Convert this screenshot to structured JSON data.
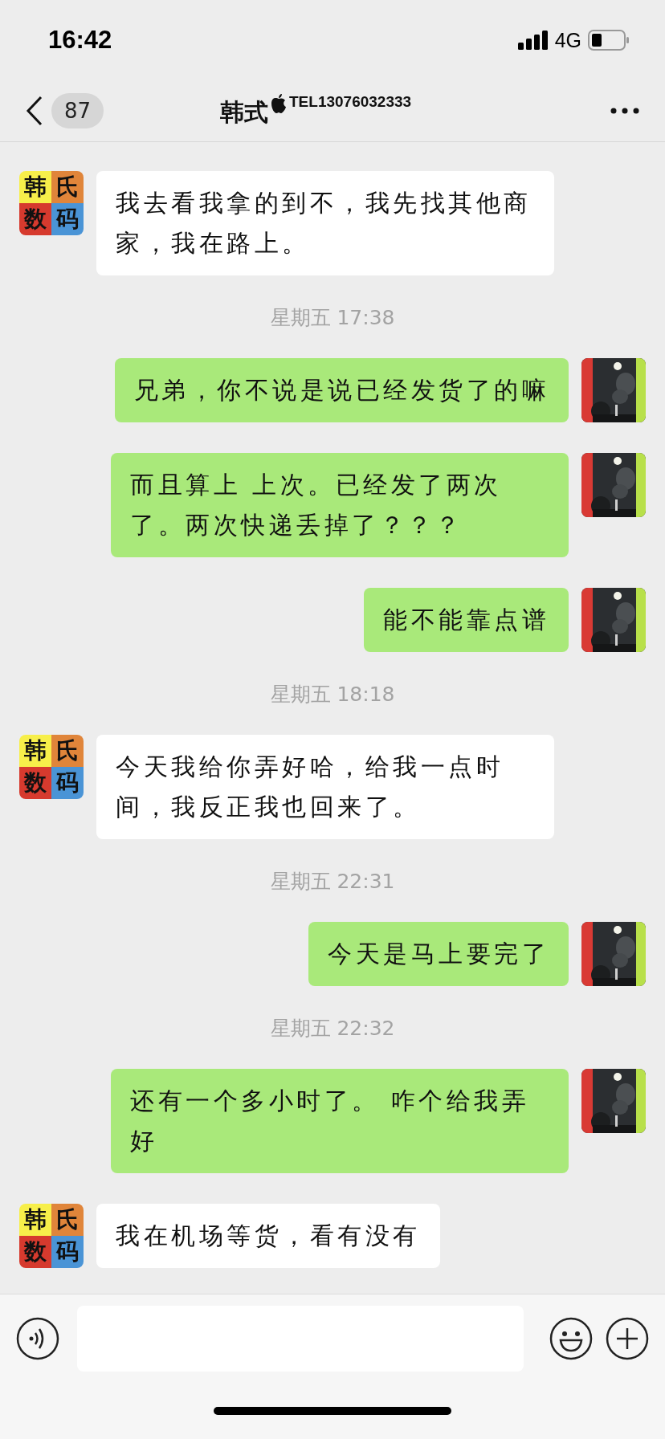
{
  "status_bar": {
    "time": "16:42",
    "network": "4G"
  },
  "nav": {
    "unread_count": "87",
    "title": "韩式",
    "title_suffix": "TEL13076032333"
  },
  "messages": [
    {
      "kind": "incoming",
      "text": "我去看我拿的到不，我先找其他商家，我在路上。",
      "avatar": [
        {
          "text": "韩",
          "color": "#f7ef4a"
        },
        {
          "text": "氏",
          "color": "#e0853a"
        },
        {
          "text": "数",
          "color": "#d63a2e"
        },
        {
          "text": "码",
          "color": "#4a94d6"
        }
      ]
    },
    {
      "kind": "time",
      "text": "星期五 17:38"
    },
    {
      "kind": "outgoing",
      "text": "兄弟，你不说是说已经发货了的嘛"
    },
    {
      "kind": "outgoing",
      "text": "而且算上 上次。已经发了两次了。两次快递丢掉了？？？"
    },
    {
      "kind": "outgoing",
      "text": "能不能靠点谱"
    },
    {
      "kind": "time",
      "text": "星期五 18:18"
    },
    {
      "kind": "incoming",
      "text": "今天我给你弄好哈，给我一点时间，我反正我也回来了。",
      "avatar": [
        {
          "text": "韩",
          "color": "#f7ef4a"
        },
        {
          "text": "氏",
          "color": "#e0853a"
        },
        {
          "text": "数",
          "color": "#d63a2e"
        },
        {
          "text": "码",
          "color": "#4a94d6"
        }
      ]
    },
    {
      "kind": "time",
      "text": "星期五 22:31"
    },
    {
      "kind": "outgoing",
      "text": "今天是马上要完了"
    },
    {
      "kind": "time",
      "text": "星期五 22:32"
    },
    {
      "kind": "outgoing",
      "text": "还有一个多小时了。 咋个给我弄好"
    },
    {
      "kind": "incoming",
      "text": "我在机场等货，看有没有",
      "avatar": [
        {
          "text": "韩",
          "color": "#f7ef4a"
        },
        {
          "text": "氏",
          "color": "#e0853a"
        },
        {
          "text": "数",
          "color": "#d63a2e"
        },
        {
          "text": "码",
          "color": "#4a94d6"
        }
      ]
    }
  ]
}
